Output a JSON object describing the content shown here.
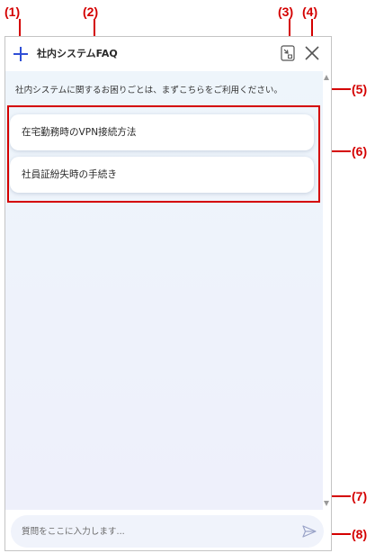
{
  "callouts": [
    "(1)",
    "(2)",
    "(3)",
    "(4)",
    "(5)",
    "(6)",
    "(7)",
    "(8)"
  ],
  "header": {
    "title": "社内システムFAQ",
    "icons": {
      "new": "plus-icon",
      "minimize": "minimize-icon",
      "close": "close-icon"
    }
  },
  "chat": {
    "welcome": "社内システムに関するお困りごとは、まずこちらをご利用ください。",
    "options": [
      "在宅勤務時のVPN接続方法",
      "社員証紛失時の手続き"
    ]
  },
  "input": {
    "value": "",
    "placeholder": "質問をここに入力します..."
  },
  "colors": {
    "accent": "#2f4fd6",
    "callout": "#d40000",
    "chat_bg": "#eef3fb"
  }
}
